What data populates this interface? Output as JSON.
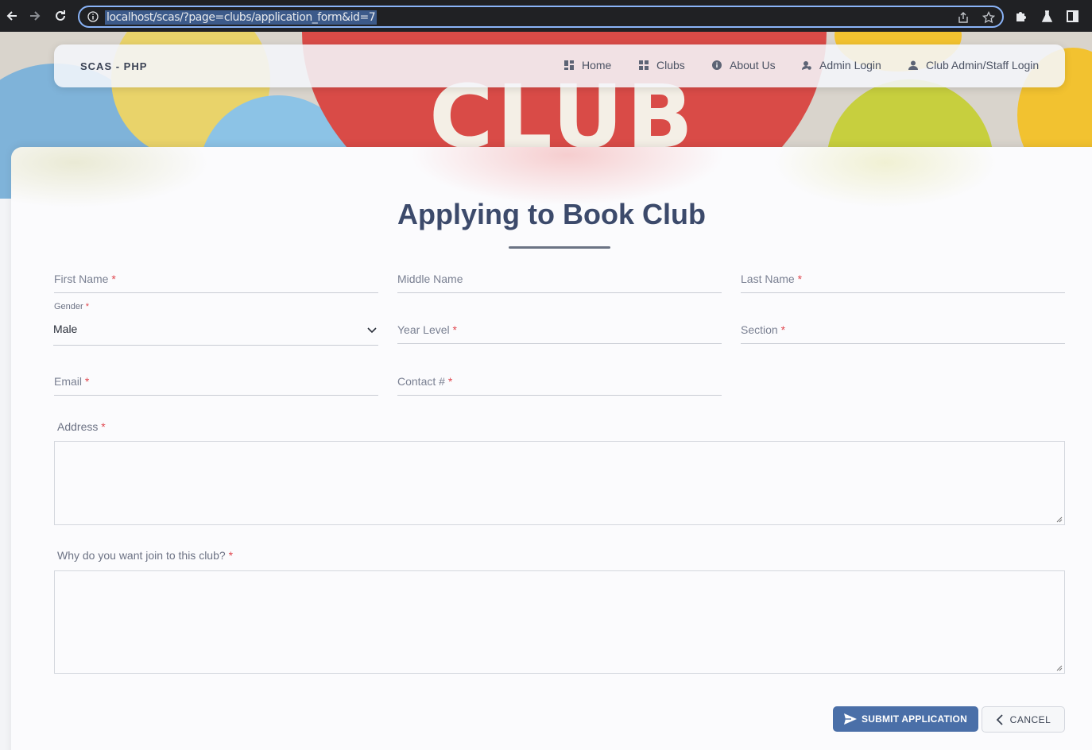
{
  "browser": {
    "url": "localhost/scas/?page=clubs/application_form&id=7",
    "icons": [
      "back-icon",
      "forward-icon",
      "reload-icon",
      "info-icon",
      "share-icon",
      "star-icon",
      "extensions-icon",
      "labs-icon",
      "side-panel-icon"
    ]
  },
  "hero": {
    "banner_text": "CLUB"
  },
  "navbar": {
    "brand": "SCAS - PHP",
    "items": [
      {
        "label": "Home",
        "icon": "dashboard-icon"
      },
      {
        "label": "Clubs",
        "icon": "grid-icon"
      },
      {
        "label": "About Us",
        "icon": "info-circle-icon"
      },
      {
        "label": "Admin Login",
        "icon": "admin-user-icon"
      },
      {
        "label": "Club Admin/Staff Login",
        "icon": "user-icon"
      }
    ]
  },
  "form": {
    "title": "Applying to Book Club",
    "required_mark": "*",
    "first_name_label": "First Name",
    "middle_name_label": "Middle Name",
    "last_name_label": "Last Name",
    "gender_label": "Gender",
    "gender_value": "Male",
    "year_level_label": "Year Level",
    "section_label": "Section",
    "email_label": "Email",
    "contact_label": "Contact #",
    "address_label": "Address",
    "reason_label": "Why do you want join to this club?",
    "submit_label": "SUBMIT APPLICATION",
    "cancel_label": "CANCEL"
  },
  "colors": {
    "accent": "#4a6fa8",
    "title": "#3c4a6b",
    "required": "#e0474f"
  }
}
